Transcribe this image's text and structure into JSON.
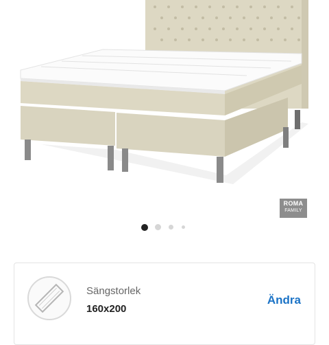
{
  "gallery": {
    "product_image": "bed-product-image",
    "brand_badge": {
      "line1": "ROMA",
      "line2": "FAMILY"
    },
    "pagination": {
      "total": 4,
      "active": 0
    }
  },
  "option_card": {
    "label": "Sängstorlek",
    "value": "160x200",
    "action_label": "Ändra",
    "icon": "mattress-size-icon"
  },
  "colors": {
    "accent": "#1b73c6",
    "fabric": "#ddd8c3",
    "active_dot": "#222222",
    "inactive_dot": "#d6d6d6"
  }
}
